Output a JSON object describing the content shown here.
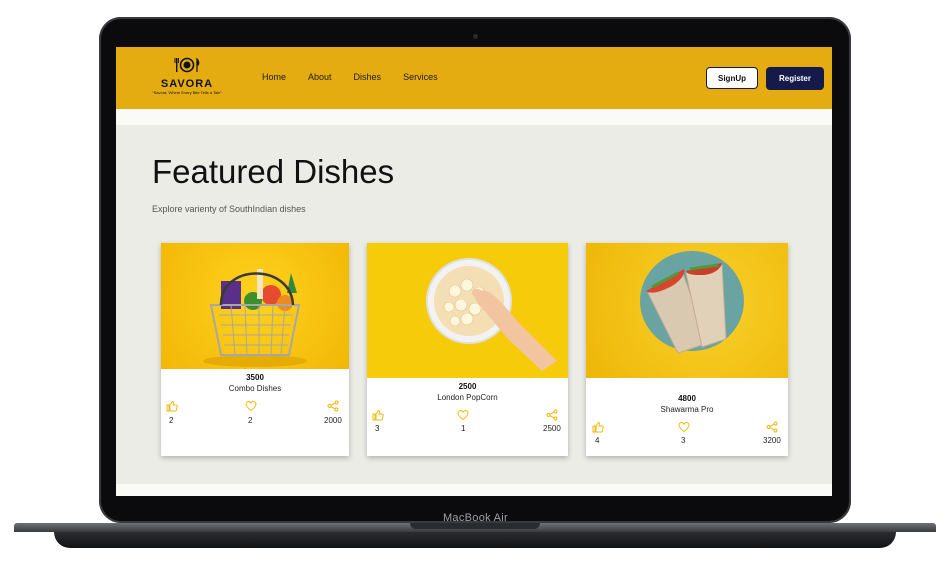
{
  "device": {
    "label": "MacBook Air"
  },
  "nav": {
    "logo_name": "SAVORA",
    "logo_tagline": "\"Savora: Where Every Bite Tells a Tale\"",
    "links": [
      "Home",
      "About",
      "Dishes",
      "Services"
    ],
    "signup_label": "SignUp",
    "register_label": "Register"
  },
  "hero": {
    "title": "Featured Dishes",
    "subtitle": "Explore varienty of SouthIndian dishes"
  },
  "cards": [
    {
      "price": "3500",
      "name": "Combo Dishes",
      "likes": "2",
      "hearts": "2",
      "shares": "2000",
      "image": "basket-image"
    },
    {
      "price": "2500",
      "name": "London PopCorn",
      "likes": "3",
      "hearts": "1",
      "shares": "2500",
      "image": "popcorn-image"
    },
    {
      "price": "4800",
      "name": "Shawarma Pro",
      "likes": "4",
      "hearts": "3",
      "shares": "3200",
      "image": "shawarma-image"
    }
  ],
  "colors": {
    "nav": "#e5ac12",
    "register_bg": "#141a4a",
    "icon_accent": "#f0b400",
    "page_bg": "#ecece6"
  }
}
